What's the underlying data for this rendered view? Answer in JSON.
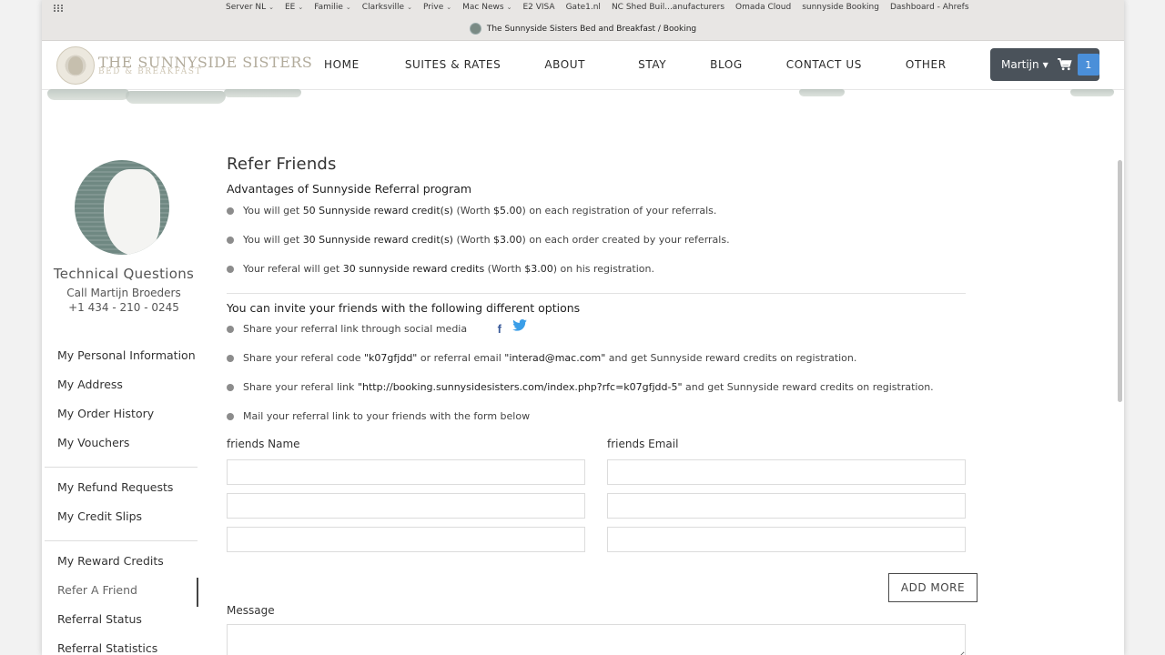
{
  "browser": {
    "bookmarks": [
      {
        "label": "Server NL",
        "has_menu": true
      },
      {
        "label": "EE",
        "has_menu": true
      },
      {
        "label": "Familie",
        "has_menu": true
      },
      {
        "label": "Clarksville",
        "has_menu": true
      },
      {
        "label": "Prive",
        "has_menu": true
      },
      {
        "label": "Mac News",
        "has_menu": true
      },
      {
        "label": "E2 VISA",
        "has_menu": false
      },
      {
        "label": "Gate1.nl",
        "has_menu": false
      },
      {
        "label": "NC Shed Buil...anufacturers",
        "has_menu": false
      },
      {
        "label": "Omada Cloud",
        "has_menu": false
      },
      {
        "label": "sunnyside Booking",
        "has_menu": false
      },
      {
        "label": "Dashboard - Ahrefs",
        "has_menu": false
      }
    ],
    "page_title": "The Sunnyside Sisters Bed and Breakfast / Booking"
  },
  "header": {
    "logo_title": "THE SUNNYSIDE SISTERS",
    "logo_subtitle": "BED & BREAKFAST",
    "nav": [
      "HOME",
      "SUITES & RATES",
      "ABOUT",
      "STAY",
      "BLOG",
      "CONTACT US",
      "OTHER"
    ],
    "user_name": "Martijn",
    "cart_count": "1"
  },
  "sidebar": {
    "contact_title": "Technical Questions",
    "contact_line1": "Call Martijn Broeders",
    "contact_line2": "+1 434 - 210 - 0245",
    "groups": [
      [
        "My Personal Information",
        "My Address",
        "My Order History",
        "My Vouchers"
      ],
      [
        "My Refund Requests",
        "My Credit Slips"
      ],
      [
        "My Reward Credits",
        "Refer A Friend",
        "Referral Status",
        "Referral Statistics"
      ]
    ],
    "active_item": "Refer A Friend"
  },
  "main": {
    "title": "Refer Friends",
    "advantages_heading": "Advantages of Sunnyside Referral program",
    "advantages": [
      {
        "pre": "You will get ",
        "b1": "50 Sunnyside reward credit(s)",
        "mid": " (Worth ",
        "b2": "$5.00",
        "post": ") on each registration of your referrals."
      },
      {
        "pre": "You will get ",
        "b1": "30 Sunnyside reward credit(s)",
        "mid": " (Worth ",
        "b2": "$3.00",
        "post": ") on each order created by your referrals."
      },
      {
        "pre": "Your referal will get ",
        "b1": "30 sunnyside reward credits",
        "mid": " (Worth ",
        "b2": "$3.00",
        "post": ") on his registration."
      }
    ],
    "options_heading": "You can invite your friends with the following different options",
    "opt_social": "Share your referral link through social media",
    "opt_code_pre": "Share your referal code ",
    "opt_code_val": "\"k07gfjdd\"",
    "opt_code_mid": " or referral email ",
    "opt_email_val": "\"interad@mac.com\"",
    "opt_code_post": " and get Sunnyside reward credits on registration.",
    "opt_link_pre": "Share your referal link ",
    "opt_link_val": "\"http://booking.sunnysidesisters.com/index.php?rfc=k07gfjdd-5\"",
    "opt_link_post": " and get Sunnyside reward credits on registration.",
    "opt_mail": "Mail your referral link to your friends with the form below",
    "col_name": "friends Name",
    "col_email": "friends Email",
    "add_more": "ADD MORE",
    "message_label": "Message"
  }
}
